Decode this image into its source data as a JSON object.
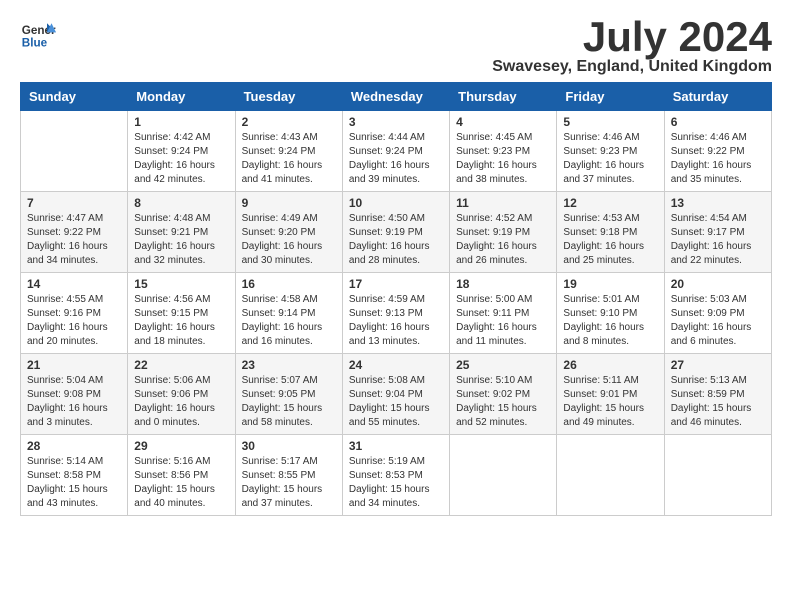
{
  "logo": {
    "line1": "General",
    "line2": "Blue"
  },
  "title": "July 2024",
  "location": "Swavesey, England, United Kingdom",
  "days": [
    "Sunday",
    "Monday",
    "Tuesday",
    "Wednesday",
    "Thursday",
    "Friday",
    "Saturday"
  ],
  "weeks": [
    [
      {
        "num": "",
        "lines": []
      },
      {
        "num": "1",
        "lines": [
          "Sunrise: 4:42 AM",
          "Sunset: 9:24 PM",
          "Daylight: 16 hours",
          "and 42 minutes."
        ]
      },
      {
        "num": "2",
        "lines": [
          "Sunrise: 4:43 AM",
          "Sunset: 9:24 PM",
          "Daylight: 16 hours",
          "and 41 minutes."
        ]
      },
      {
        "num": "3",
        "lines": [
          "Sunrise: 4:44 AM",
          "Sunset: 9:24 PM",
          "Daylight: 16 hours",
          "and 39 minutes."
        ]
      },
      {
        "num": "4",
        "lines": [
          "Sunrise: 4:45 AM",
          "Sunset: 9:23 PM",
          "Daylight: 16 hours",
          "and 38 minutes."
        ]
      },
      {
        "num": "5",
        "lines": [
          "Sunrise: 4:46 AM",
          "Sunset: 9:23 PM",
          "Daylight: 16 hours",
          "and 37 minutes."
        ]
      },
      {
        "num": "6",
        "lines": [
          "Sunrise: 4:46 AM",
          "Sunset: 9:22 PM",
          "Daylight: 16 hours",
          "and 35 minutes."
        ]
      }
    ],
    [
      {
        "num": "7",
        "lines": [
          "Sunrise: 4:47 AM",
          "Sunset: 9:22 PM",
          "Daylight: 16 hours",
          "and 34 minutes."
        ]
      },
      {
        "num": "8",
        "lines": [
          "Sunrise: 4:48 AM",
          "Sunset: 9:21 PM",
          "Daylight: 16 hours",
          "and 32 minutes."
        ]
      },
      {
        "num": "9",
        "lines": [
          "Sunrise: 4:49 AM",
          "Sunset: 9:20 PM",
          "Daylight: 16 hours",
          "and 30 minutes."
        ]
      },
      {
        "num": "10",
        "lines": [
          "Sunrise: 4:50 AM",
          "Sunset: 9:19 PM",
          "Daylight: 16 hours",
          "and 28 minutes."
        ]
      },
      {
        "num": "11",
        "lines": [
          "Sunrise: 4:52 AM",
          "Sunset: 9:19 PM",
          "Daylight: 16 hours",
          "and 26 minutes."
        ]
      },
      {
        "num": "12",
        "lines": [
          "Sunrise: 4:53 AM",
          "Sunset: 9:18 PM",
          "Daylight: 16 hours",
          "and 25 minutes."
        ]
      },
      {
        "num": "13",
        "lines": [
          "Sunrise: 4:54 AM",
          "Sunset: 9:17 PM",
          "Daylight: 16 hours",
          "and 22 minutes."
        ]
      }
    ],
    [
      {
        "num": "14",
        "lines": [
          "Sunrise: 4:55 AM",
          "Sunset: 9:16 PM",
          "Daylight: 16 hours",
          "and 20 minutes."
        ]
      },
      {
        "num": "15",
        "lines": [
          "Sunrise: 4:56 AM",
          "Sunset: 9:15 PM",
          "Daylight: 16 hours",
          "and 18 minutes."
        ]
      },
      {
        "num": "16",
        "lines": [
          "Sunrise: 4:58 AM",
          "Sunset: 9:14 PM",
          "Daylight: 16 hours",
          "and 16 minutes."
        ]
      },
      {
        "num": "17",
        "lines": [
          "Sunrise: 4:59 AM",
          "Sunset: 9:13 PM",
          "Daylight: 16 hours",
          "and 13 minutes."
        ]
      },
      {
        "num": "18",
        "lines": [
          "Sunrise: 5:00 AM",
          "Sunset: 9:11 PM",
          "Daylight: 16 hours",
          "and 11 minutes."
        ]
      },
      {
        "num": "19",
        "lines": [
          "Sunrise: 5:01 AM",
          "Sunset: 9:10 PM",
          "Daylight: 16 hours",
          "and 8 minutes."
        ]
      },
      {
        "num": "20",
        "lines": [
          "Sunrise: 5:03 AM",
          "Sunset: 9:09 PM",
          "Daylight: 16 hours",
          "and 6 minutes."
        ]
      }
    ],
    [
      {
        "num": "21",
        "lines": [
          "Sunrise: 5:04 AM",
          "Sunset: 9:08 PM",
          "Daylight: 16 hours",
          "and 3 minutes."
        ]
      },
      {
        "num": "22",
        "lines": [
          "Sunrise: 5:06 AM",
          "Sunset: 9:06 PM",
          "Daylight: 16 hours",
          "and 0 minutes."
        ]
      },
      {
        "num": "23",
        "lines": [
          "Sunrise: 5:07 AM",
          "Sunset: 9:05 PM",
          "Daylight: 15 hours",
          "and 58 minutes."
        ]
      },
      {
        "num": "24",
        "lines": [
          "Sunrise: 5:08 AM",
          "Sunset: 9:04 PM",
          "Daylight: 15 hours",
          "and 55 minutes."
        ]
      },
      {
        "num": "25",
        "lines": [
          "Sunrise: 5:10 AM",
          "Sunset: 9:02 PM",
          "Daylight: 15 hours",
          "and 52 minutes."
        ]
      },
      {
        "num": "26",
        "lines": [
          "Sunrise: 5:11 AM",
          "Sunset: 9:01 PM",
          "Daylight: 15 hours",
          "and 49 minutes."
        ]
      },
      {
        "num": "27",
        "lines": [
          "Sunrise: 5:13 AM",
          "Sunset: 8:59 PM",
          "Daylight: 15 hours",
          "and 46 minutes."
        ]
      }
    ],
    [
      {
        "num": "28",
        "lines": [
          "Sunrise: 5:14 AM",
          "Sunset: 8:58 PM",
          "Daylight: 15 hours",
          "and 43 minutes."
        ]
      },
      {
        "num": "29",
        "lines": [
          "Sunrise: 5:16 AM",
          "Sunset: 8:56 PM",
          "Daylight: 15 hours",
          "and 40 minutes."
        ]
      },
      {
        "num": "30",
        "lines": [
          "Sunrise: 5:17 AM",
          "Sunset: 8:55 PM",
          "Daylight: 15 hours",
          "and 37 minutes."
        ]
      },
      {
        "num": "31",
        "lines": [
          "Sunrise: 5:19 AM",
          "Sunset: 8:53 PM",
          "Daylight: 15 hours",
          "and 34 minutes."
        ]
      },
      {
        "num": "",
        "lines": []
      },
      {
        "num": "",
        "lines": []
      },
      {
        "num": "",
        "lines": []
      }
    ]
  ]
}
